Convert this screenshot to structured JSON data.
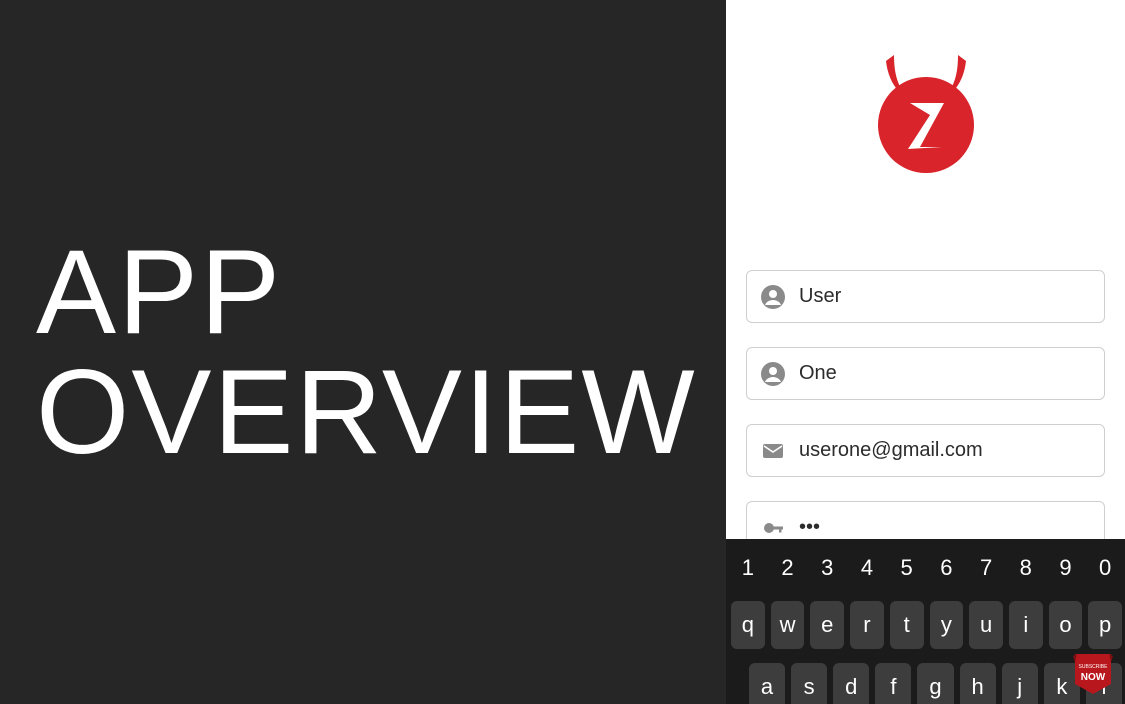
{
  "left": {
    "title": "APP OVERVIEW"
  },
  "form": {
    "first_name": {
      "value": "User"
    },
    "last_name": {
      "value": "One"
    },
    "email": {
      "value": "userone@gmail.com"
    },
    "password": {
      "value": "•••"
    }
  },
  "keyboard": {
    "row_numbers": [
      "1",
      "2",
      "3",
      "4",
      "5",
      "6",
      "7",
      "8",
      "9",
      "0"
    ],
    "row_letters1": [
      "q",
      "w",
      "e",
      "r",
      "t",
      "y",
      "u",
      "i",
      "o",
      "p"
    ],
    "row_letters2": [
      "a",
      "s",
      "d",
      "f",
      "g",
      "h",
      "j",
      "k",
      "l"
    ]
  },
  "badge": {
    "label": "SUBSCRIBE NOW"
  },
  "colors": {
    "brand_red": "#d8242a",
    "dark_bg": "#262626"
  }
}
